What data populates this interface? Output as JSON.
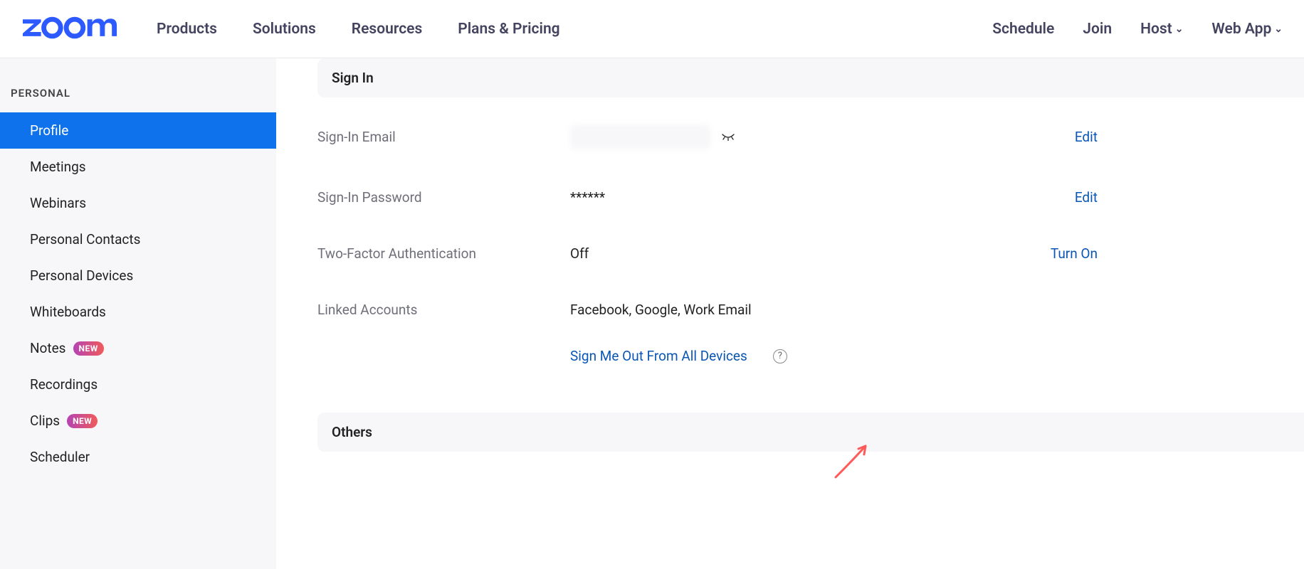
{
  "nav": {
    "logo": "zoom",
    "left": [
      "Products",
      "Solutions",
      "Resources",
      "Plans & Pricing"
    ],
    "right": [
      {
        "label": "Schedule",
        "dropdown": false
      },
      {
        "label": "Join",
        "dropdown": false
      },
      {
        "label": "Host",
        "dropdown": true
      },
      {
        "label": "Web App",
        "dropdown": true
      }
    ]
  },
  "sidebar": {
    "heading": "PERSONAL",
    "items": [
      {
        "label": "Profile",
        "active": true
      },
      {
        "label": "Meetings"
      },
      {
        "label": "Webinars"
      },
      {
        "label": "Personal Contacts"
      },
      {
        "label": "Personal Devices"
      },
      {
        "label": "Whiteboards"
      },
      {
        "label": "Notes",
        "badge": "NEW"
      },
      {
        "label": "Recordings"
      },
      {
        "label": "Clips",
        "badge": "NEW"
      },
      {
        "label": "Scheduler"
      }
    ]
  },
  "sections": {
    "signin": {
      "title": "Sign In",
      "rows": {
        "email": {
          "label": "Sign-In Email",
          "value": "",
          "masked": true,
          "action": "Edit"
        },
        "password": {
          "label": "Sign-In Password",
          "value": "******",
          "action": "Edit"
        },
        "tfa": {
          "label": "Two-Factor Authentication",
          "value": "Off",
          "action": "Turn On"
        },
        "linked": {
          "label": "Linked Accounts",
          "value": "Facebook, Google, Work Email"
        }
      },
      "signout_all": "Sign Me Out From All Devices"
    },
    "others": {
      "title": "Others"
    }
  },
  "icons": {
    "closed_eye": "closed-eye-icon",
    "help": "?"
  }
}
